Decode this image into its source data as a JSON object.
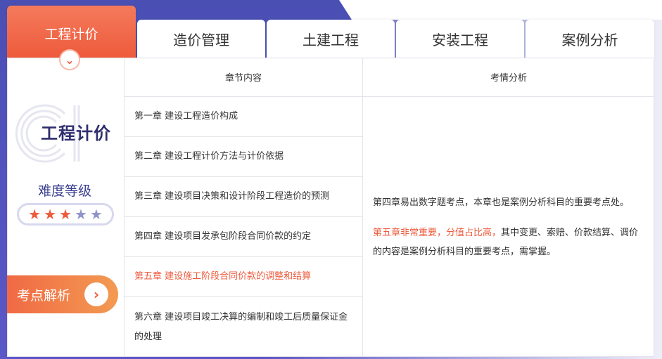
{
  "tabs": [
    {
      "label": "工程计价",
      "active": true
    },
    {
      "label": "造价管理",
      "active": false
    },
    {
      "label": "土建工程",
      "active": false
    },
    {
      "label": "安装工程",
      "active": false
    },
    {
      "label": "案例分析",
      "active": false
    }
  ],
  "left_panel": {
    "subject_title": "工程计价",
    "difficulty_label": "难度等级",
    "difficulty_rating": 3,
    "difficulty_max": 5,
    "analysis_button_label": "考点解析"
  },
  "table": {
    "headers": [
      "章节内容",
      "考情分析"
    ],
    "chapters": [
      "第一章 建设工程造价构成",
      "第二章 建设工程计价方法与计价依据",
      "第三章 建设项目决策和设计阶段工程造价的预测",
      "第四章 建设项目发承包阶段合同价款的约定",
      "第五章 建设施工阶段合同价款的调整和结算",
      "第六章 建设项目竣工决算的编制和竣工后质量保证金的处理"
    ],
    "highlighted_chapter_index": 4,
    "analysis": {
      "para1": "第四章易出数字题考点，本章也是案例分析科目的重要考点处。",
      "para2_highlight": "第五章非常重要，分值占比高，",
      "para2_rest": "其中变更、索赔、价款结算、调价的内容是案例分析科目的重要考点，需掌握。"
    }
  },
  "colors": {
    "accent": "#ee5b3c",
    "brand_purple": "#4a4fb4"
  }
}
